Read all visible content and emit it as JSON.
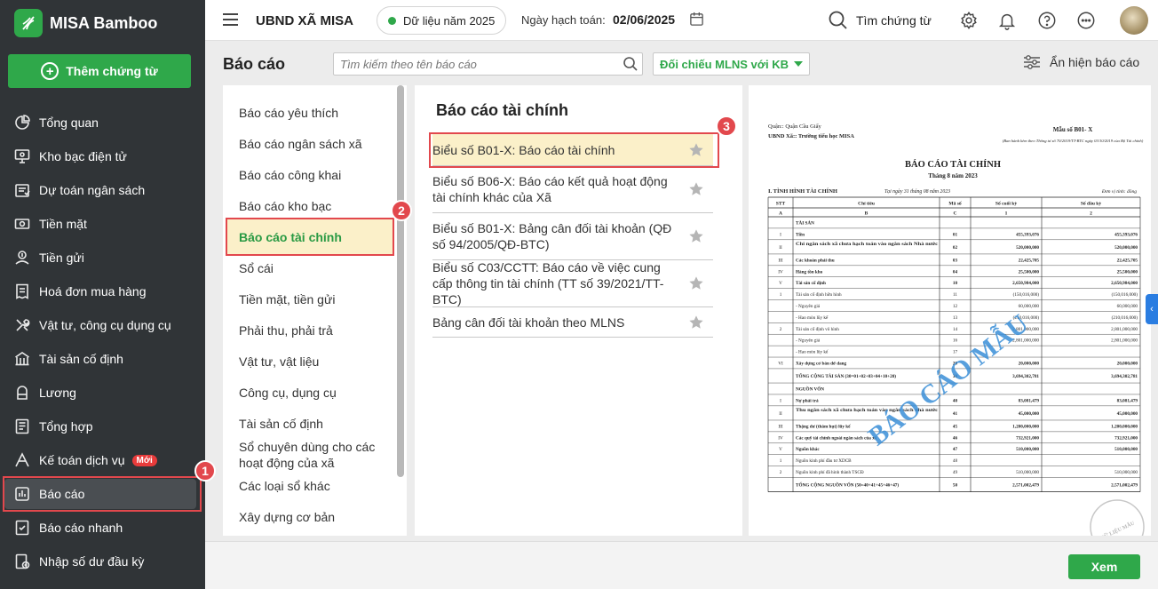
{
  "app": {
    "name": "MISA Bamboo"
  },
  "sidebar": {
    "add_button": "Thêm chứng từ",
    "items": [
      {
        "label": "Tổng quan",
        "icon": "pie-chart-icon"
      },
      {
        "label": "Kho bạc điện tử",
        "icon": "monitor-icon"
      },
      {
        "label": "Dự toán ngân sách",
        "icon": "budget-icon"
      },
      {
        "label": "Tiền mặt",
        "icon": "cash-icon"
      },
      {
        "label": "Tiền gửi",
        "icon": "deposit-icon"
      },
      {
        "label": "Hoá đơn mua hàng",
        "icon": "invoice-icon"
      },
      {
        "label": "Vật tư, công cụ dụng cụ",
        "icon": "tools-icon"
      },
      {
        "label": "Tài sản cố định",
        "icon": "building-icon"
      },
      {
        "label": "Lương",
        "icon": "salary-icon"
      },
      {
        "label": "Tổng hợp",
        "icon": "summary-icon"
      },
      {
        "label": "Kế toán dịch vụ",
        "icon": "service-icon",
        "badge": "Mới"
      },
      {
        "label": "Báo cáo",
        "icon": "report-icon"
      },
      {
        "label": "Báo cáo nhanh",
        "icon": "quick-report-icon"
      },
      {
        "label": "Nhập số dư đầu kỳ",
        "icon": "opening-balance-icon"
      }
    ],
    "active_item": "Báo cáo"
  },
  "header": {
    "org": "UBND XÃ MISA",
    "year_status": "Dữ liệu năm 2025",
    "date_label": "Ngày hạch toán:",
    "date_value": "02/06/2025",
    "search_label": "Tìm chứng từ"
  },
  "page": {
    "title": "Báo cáo",
    "search_placeholder": "Tìm kiếm theo tên báo cáo",
    "filter_value": "Đối chiếu MLNS với KB",
    "toggle_label": "Ẩn hiện báo cáo",
    "view_button": "Xem"
  },
  "categories": [
    "Báo cáo yêu thích",
    "Báo cáo ngân sách xã",
    "Báo cáo công khai",
    "Báo cáo kho bạc",
    "Báo cáo tài chính",
    "Sổ cái",
    "Tiền mặt, tiền gửi",
    "Phải thu, phải trả",
    "Vật tư, vật liệu",
    "Công cụ, dụng cụ",
    "Tài sản cố định",
    "Sổ chuyên dùng cho các hoạt động của xã",
    "Các loại sổ khác",
    "Xây dựng cơ bản"
  ],
  "selected_category": "Báo cáo tài chính",
  "reports": {
    "heading": "Báo cáo tài chính",
    "items": [
      "Biểu số B01-X: Báo cáo tài chính",
      "Biểu số B06-X: Báo cáo kết quả hoạt động tài chính khác của Xã",
      "Biểu số B01-X: Bảng cân đối tài khoản (QĐ số 94/2005/QĐ-BTC)",
      "Biểu số C03/CCTT: Báo cáo về việc cung cấp thông tin tài chính (TT số 39/2021/TT-BTC)",
      "Bảng cân đối tài khoản theo MLNS"
    ]
  },
  "steps": [
    "1",
    "2",
    "3"
  ],
  "preview": {
    "org_line1": "Quận:: Quận Cầu Giấy",
    "org_line2": "UBND Xã:: Trường tiểu học MISA",
    "form_no": "Mẫu số B01- X",
    "form_note": "(Ban hành kèm theo Thông tư số 70/2019/TT-BTC ngày 03/10/2019 của Bộ Tài chính)",
    "title": "BÁO CÁO TÀI CHÍNH",
    "period": "Tháng 8 năm 2023",
    "section": "I. TÌNH HÌNH TÀI CHÍNH",
    "as_of": "Tại ngày 31 tháng 08 năm 2023",
    "unit": "Đơn vị tính: đồng",
    "watermark": "BÁO CÁO MẪU",
    "stamp": "DỮ LIỆU MẪU",
    "columns": [
      "STT",
      "Chỉ tiêu",
      "Mã số",
      "Số cuối kỳ",
      "Số đầu kỳ"
    ],
    "col_codes": [
      "A",
      "B",
      "C",
      "1",
      "2"
    ],
    "rows": [
      [
        "",
        "TÀI SẢN",
        "",
        "",
        ""
      ],
      [
        "I",
        "Tiền",
        "01",
        "455,393,076",
        "455,393,076"
      ],
      [
        "II",
        "Chi ngân sách xã chưa hạch toán vào ngân sách Nhà nước",
        "02",
        "520,000,000",
        "520,000,000"
      ],
      [
        "III",
        "Các khoản phải thu",
        "03",
        "22,425,705",
        "22,425,705"
      ],
      [
        "IV",
        "Hàng tồn kho",
        "04",
        "25,500,000",
        "25,500,000"
      ],
      [
        "V",
        "Tài sản cố định",
        "10",
        "2,650,984,000",
        "2,650,984,000"
      ],
      [
        "1",
        "Tài sản cố định hữu hình",
        "11",
        "(150,016,000)",
        "(150,016,000)"
      ],
      [
        "",
        "- Nguyên giá",
        "12",
        "60,000,000",
        "60,000,000"
      ],
      [
        "",
        "- Hao mòn lũy kế",
        "13",
        "(210,016,000)",
        "(210,016,000)"
      ],
      [
        "2",
        "Tài sản cố định vô hình",
        "14",
        "2,801,000,000",
        "2,801,000,000"
      ],
      [
        "",
        "- Nguyên giá",
        "16",
        "2,801,000,000",
        "2,801,000,000"
      ],
      [
        "",
        "- Hao mòn lũy kế",
        "17",
        "",
        ""
      ],
      [
        "VI",
        "Xây dựng cơ bản dở dang",
        "20",
        "20,000,000",
        "20,000,000"
      ],
      [
        "",
        "TỔNG CỘNG TÀI SẢN (30=01+02+03+04+10+20)",
        "30",
        "3,694,302,781",
        "3,694,302,781"
      ],
      [
        "",
        "NGUỒN VỐN",
        "",
        "",
        ""
      ],
      [
        "I",
        "Nợ phải trả",
        "40",
        "83,081,479",
        "83,081,479"
      ],
      [
        "II",
        "Thu ngân sách xã chưa hạch toán vào ngân sách nhà nước",
        "41",
        "45,000,000",
        "45,000,000"
      ],
      [
        "III",
        "Thặng dư (thâm hụt) lũy kế",
        "45",
        "1,200,000,000",
        "1,200,000,000"
      ],
      [
        "IV",
        "Các quỹ tài chính ngoài ngân sách của xã",
        "46",
        "732,921,000",
        "732,921,000"
      ],
      [
        "V",
        "Nguồn khác",
        "47",
        "510,000,000",
        "510,000,000"
      ],
      [
        "1",
        "Nguồn kinh phí đầu tư XDCB",
        "48",
        "",
        ""
      ],
      [
        "2",
        "Nguồn kinh phí đã hình thành TSCĐ",
        "49",
        "510,000,000",
        "510,000,000"
      ],
      [
        "",
        "TỔNG CỘNG NGUỒN VỐN (50=40+41+45+46+47)",
        "50",
        "2,571,002,479",
        "2,571,002,479"
      ]
    ]
  }
}
